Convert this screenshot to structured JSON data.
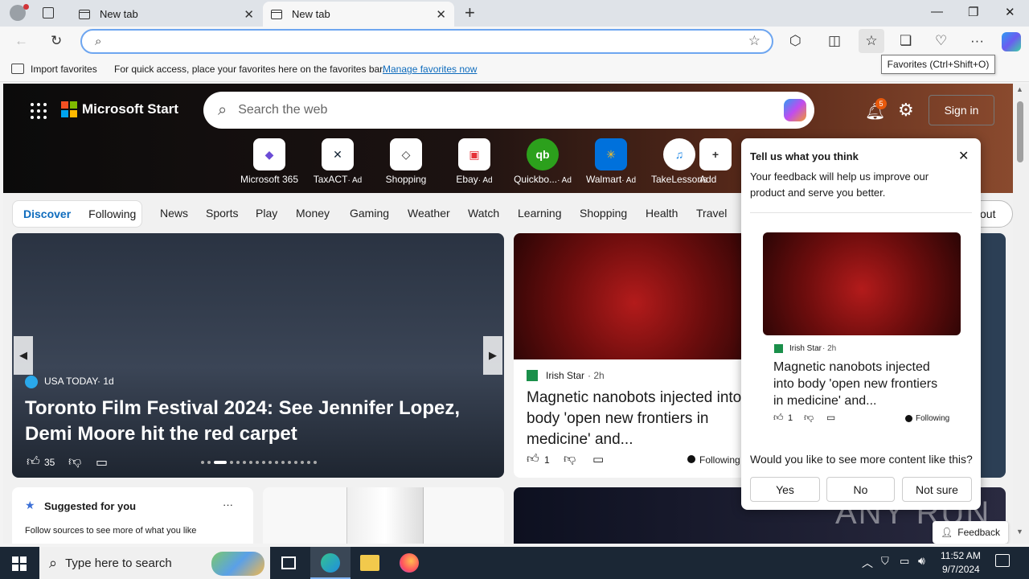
{
  "browser": {
    "tabs": [
      {
        "label": "New tab"
      },
      {
        "label": "New tab"
      }
    ],
    "address": {
      "value": "",
      "placeholder": ""
    },
    "tooltip": "Favorites (Ctrl+Shift+O)"
  },
  "favorites_bar": {
    "import_label": "Import favorites",
    "message": "For quick access, place your favorites here on the favorites bar.",
    "manage_link": "Manage favorites now"
  },
  "header": {
    "brand": "Microsoft Start",
    "search_placeholder": "Search the web",
    "notification_count": "5",
    "signin": "Sign in"
  },
  "apps": [
    {
      "label": "Microsoft 365",
      "ad": ""
    },
    {
      "label": "TaxACT",
      "ad": "· Ad"
    },
    {
      "label": "Shopping",
      "ad": ""
    },
    {
      "label": "Ebay",
      "ad": "· Ad"
    },
    {
      "label": "Quickbo...",
      "ad": "· Ad"
    },
    {
      "label": "Walmart",
      "ad": "· Ad"
    },
    {
      "label": "TakeLessons",
      "ad": ""
    },
    {
      "label": "Add",
      "ad": ""
    }
  ],
  "nav": {
    "discover": "Discover",
    "following": "Following",
    "items": [
      "News",
      "Sports",
      "Play",
      "Money",
      "Gaming",
      "Weather",
      "Watch",
      "Learning",
      "Shopping",
      "Health",
      "Travel"
    ],
    "out_fragment": "out"
  },
  "feature_card": {
    "source": "USA TODAY",
    "age": "· 1d",
    "headline": "Toronto Film Festival 2024: See Jennifer Lopez, Demi Moore hit the red carpet",
    "likes": "35"
  },
  "story_card": {
    "source": "Irish Star",
    "age": "· 2h",
    "headline": "Magnetic nanobots injected into body 'open new frontiers in medicine' and...",
    "likes": "1",
    "following": "Following"
  },
  "suggested": {
    "title": "Suggested for you",
    "more": "···",
    "body": "Follow sources to see more of what you like"
  },
  "feedback_popup": {
    "title": "Tell us what you think",
    "body": "Your feedback will help us improve our product and serve you better.",
    "source": "Irish Star",
    "age": "· 2h",
    "headline": "Magnetic nanobots injected into body 'open new frontiers in medicine' and...",
    "likes": "1",
    "following": "Following",
    "question": "Would you like to see more content like this?",
    "yes": "Yes",
    "no": "No",
    "not_sure": "Not sure"
  },
  "feedback_button": "Feedback",
  "watermark": "ANY RUN",
  "taskbar": {
    "search_placeholder": "Type here to search",
    "time": "11:52 AM",
    "date": "9/7/2024"
  },
  "colors": {
    "accent": "#0f6cbd",
    "notification": "#e8590c"
  }
}
